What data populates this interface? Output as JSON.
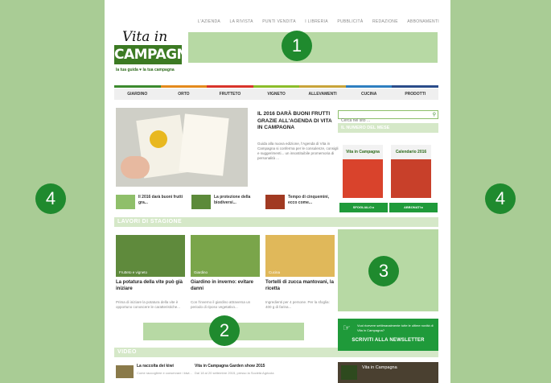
{
  "top_nav": [
    "L'AZIENDA",
    "LA RIVISTA",
    "PUNTI VENDITA",
    "I LIBRERIA",
    "PUBBLICITÀ",
    "REDAZIONE",
    "ABBONAMENTI"
  ],
  "logo": {
    "script": "Vita in",
    "caps": "CAMPAGNA",
    "tagline": "la tua guida ♥ la tua campagna"
  },
  "category_colors": [
    "#3c8a2e",
    "#e48a1c",
    "#d8342a",
    "#8cbc2a",
    "#c8a43a",
    "#2e7fc0",
    "#2a4c8a"
  ],
  "categories": [
    "GIARDINO",
    "ORTO",
    "FRUTTETO",
    "VIGNETO",
    "ALLEVAMENTI",
    "CUCINA",
    "PRODOTTI"
  ],
  "featured": {
    "title": "IL 2016 DARÀ BUONI FRUTTI GRAZIE ALL'AGENDA DI VITA IN CAMPAGNA",
    "text": "Guida alla nuova edizione, l'Agenda di Vita in Campagna si conferma per le consulenze, consigli e suggerimenti... un insostituibile promemoria di personalità ..."
  },
  "mini_articles": [
    {
      "title": "Il 2016 darà buoni frutti gra...",
      "color": "#8fbf6a"
    },
    {
      "title": "La protezione della biodiversi...",
      "color": "#5c8a3a"
    },
    {
      "title": "Tempo di cinquemini, ecco come...",
      "color": "#a13a22"
    }
  ],
  "season_section": {
    "title": "LAVORI DI STAGIONE"
  },
  "season_articles": [
    {
      "category": "Frutteto e vigneto",
      "title": "La potatura della vite può già iniziare",
      "text": "Prima di iniziare la potatura della vite è opportuno conoscere le caratteristiche...",
      "color": "#5f8a3c"
    },
    {
      "category": "Giardino",
      "title": "Giardino in inverno: evitare danni",
      "text": "Con l'inverno il giardino attraversa un periodo di riposo vegetativo...",
      "color": "#7aa54a"
    },
    {
      "category": "Cucina",
      "title": "Tortelli di zucca mantovani, la ricetta",
      "text": "Ingredienti per 4 persone. Per la sfoglia: 400 g di farina...",
      "color": "#e0b85a"
    }
  ],
  "video_section": {
    "title": "VIDEO"
  },
  "videos": [
    {
      "title": "La raccolta dei kiwi",
      "desc": "Come raccogliere e conservare i kiwi..."
    },
    {
      "title": "Vita in Campagna Garden show 2015",
      "desc": "Dal 18 al 20 settembre 2015, presso la Società Agricola"
    }
  ],
  "search": {
    "placeholder": "Cerca nel sito ..."
  },
  "magazine": {
    "title": "IL NUMERO DEL MESE",
    "covers": [
      "Vita in Campagna",
      "Calendario 2016"
    ],
    "buttons": [
      "SFOGLIALO ▸",
      "ABBONATI ▸"
    ],
    "cover_colors": [
      "#d9432c",
      "#c8402a"
    ]
  },
  "newsletter": {
    "small": "Vuoi ricevere settimanalmente tutte le ultime novità di Vita in Campagna?",
    "big": "SCRIVITI ALLA NEWSLETTER"
  },
  "youtube": {
    "title": "Vita in Campagna"
  },
  "badges": [
    "1",
    "2",
    "3",
    "4",
    "4"
  ]
}
